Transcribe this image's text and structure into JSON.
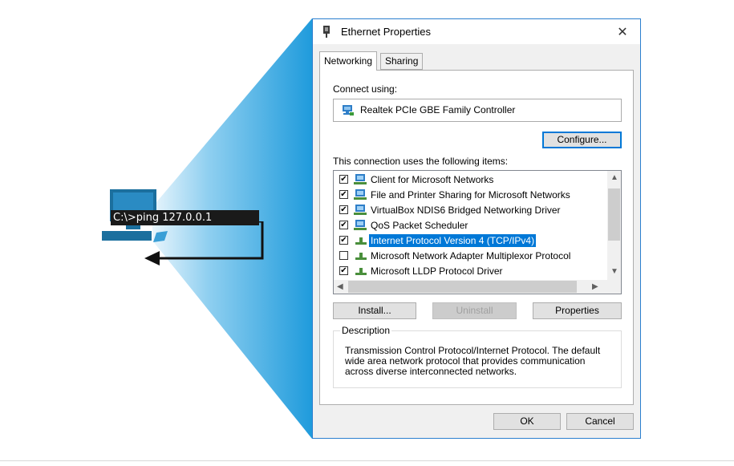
{
  "illustration": {
    "command": "C:\\>ping 127.0.0.1",
    "beam_color": "#2aa4e0"
  },
  "dialog": {
    "title": "Ethernet Properties",
    "close_glyph": "✕",
    "tabs": [
      {
        "label": "Networking",
        "active": true
      },
      {
        "label": "Sharing",
        "active": false
      }
    ],
    "connect_using_label": "Connect using:",
    "adapter_name": "Realtek PCIe GBE Family Controller",
    "configure_label": "Configure...",
    "items_label": "This connection uses the following items:",
    "items": [
      {
        "label": "Client for Microsoft Networks",
        "checked": true,
        "icon": "network-client-icon"
      },
      {
        "label": "File and Printer Sharing for Microsoft Networks",
        "checked": true,
        "icon": "network-service-icon"
      },
      {
        "label": "VirtualBox NDIS6 Bridged Networking Driver",
        "checked": true,
        "icon": "network-service-icon"
      },
      {
        "label": "QoS Packet Scheduler",
        "checked": true,
        "icon": "network-service-icon"
      },
      {
        "label": "Internet Protocol Version 4 (TCP/IPv4)",
        "checked": true,
        "icon": "protocol-icon",
        "selected": true
      },
      {
        "label": "Microsoft Network Adapter Multiplexor Protocol",
        "checked": false,
        "icon": "protocol-icon"
      },
      {
        "label": "Microsoft LLDP Protocol Driver",
        "checked": true,
        "icon": "protocol-icon"
      }
    ],
    "install_label": "Install...",
    "uninstall_label": "Uninstall",
    "properties_label": "Properties",
    "description_legend": "Description",
    "description_text": "Transmission Control Protocol/Internet Protocol. The default wide area network protocol that provides communication across diverse interconnected networks.",
    "ok_label": "OK",
    "cancel_label": "Cancel",
    "accent_color": "#0078d7"
  }
}
